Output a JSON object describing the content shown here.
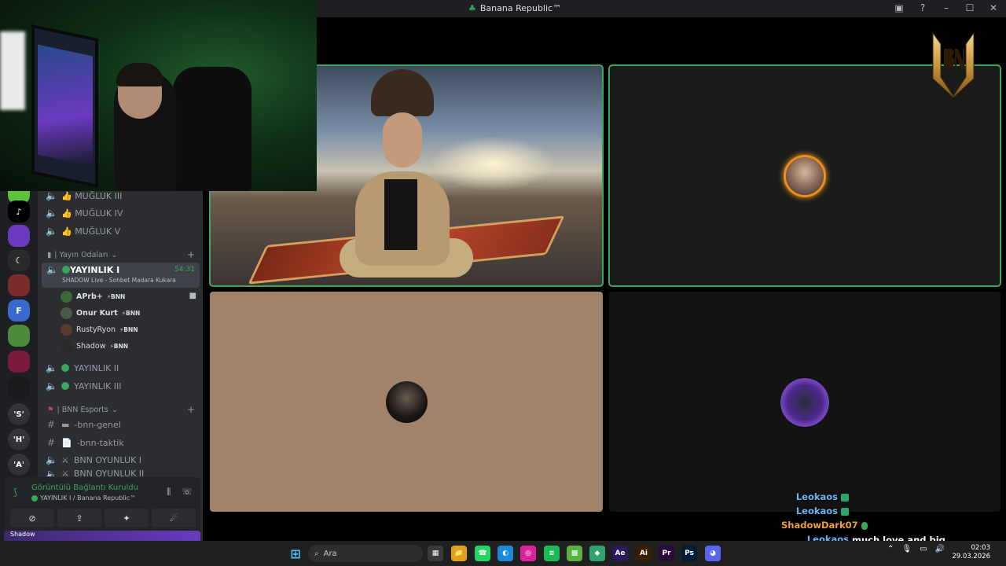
{
  "window": {
    "title": "Banana Republic™"
  },
  "sidebar": {
    "servers": [
      {
        "label": "",
        "color": "#5dc23a"
      },
      {
        "label": "♪",
        "color": "#000000"
      },
      {
        "label": "",
        "color": "#6a3ac0"
      },
      {
        "label": "☾",
        "color": "#2a2a2a"
      },
      {
        "label": "",
        "color": "#7a2a2a"
      },
      {
        "label": "F",
        "color": "#3a6ad0"
      },
      {
        "label": "",
        "color": "#4a8a3a"
      },
      {
        "label": "",
        "color": "#7a1a3a"
      },
      {
        "label": "",
        "color": "#1a1a1a"
      },
      {
        "label": "'S'",
        "color": "#313338"
      },
      {
        "label": "'H'",
        "color": "#313338"
      },
      {
        "label": "'A'",
        "color": "#313338"
      }
    ],
    "top_channels": [
      {
        "icon": "🔈",
        "label": "👍 MUĞLUK III"
      },
      {
        "icon": "🔈",
        "label": "👍 MUĞLUK IV"
      },
      {
        "icon": "🔈",
        "label": "👍 MUĞLUK V"
      }
    ],
    "category_stream": {
      "label": "| Yayın Odaları",
      "icon": "▮"
    },
    "active_channel": {
      "name": "YAYINLIK I",
      "timer": "54:31",
      "status": "SHADOW Live - Sohbet Madara Kukara"
    },
    "members": [
      {
        "name": "APrb+",
        "tag": "⚡BNN",
        "camera": true
      },
      {
        "name": "Onur Kurt",
        "tag": "⚡BNN",
        "camera": false
      },
      {
        "name": "RustyRyon",
        "tag": "⚡BNN",
        "camera": false
      },
      {
        "name": "Shadow",
        "tag": "⚡BNN",
        "camera": false
      }
    ],
    "more_stream_channels": [
      {
        "label": "YAYINLIK II"
      },
      {
        "label": "YAYINLIK III"
      }
    ],
    "category_esports": {
      "label": "| BNN Esports"
    },
    "esports_channels": [
      {
        "icon": "#",
        "label": "-bnn-genel",
        "emoji": "▬"
      },
      {
        "icon": "#",
        "label": "-bnn-taktik",
        "emoji": "📄"
      },
      {
        "icon": "🔈",
        "label": "BNN OYUNLUK I",
        "emoji": "⚔"
      },
      {
        "icon": "🔈",
        "label": "BNN OYUNLUK II",
        "emoji": "⚔"
      }
    ],
    "voice_panel": {
      "status": "Görüntülü Bağlantı Kuruldu",
      "subtitle": "YAYINLIK I / Banana Republic™",
      "buttons": [
        "⊘",
        "⇪",
        "✦",
        "☄"
      ]
    },
    "user_strip": "Shadow"
  },
  "chat": [
    {
      "nick": "Leokaos",
      "color": "#6cb4f0",
      "message": ""
    },
    {
      "nick": "Leokaos",
      "color": "#6cb4f0",
      "message": ""
    },
    {
      "nick": "ShadowDark07",
      "color": "#f0a030",
      "message": ""
    },
    {
      "nick": "Leokaos",
      "color": "#6cb4f0",
      "message": "much love and big support! lets go!"
    }
  ],
  "taskbar": {
    "search_placeholder": "Ara",
    "time": "02:03",
    "date": "29.03.2026",
    "apps": [
      {
        "label": "▦",
        "color": "#3a3a3a"
      },
      {
        "label": "📁",
        "color": "#e0a020"
      },
      {
        "label": "☎",
        "color": "#25d366"
      },
      {
        "label": "◐",
        "color": "#1a8ad8"
      },
      {
        "label": "◎",
        "color": "#d6249f"
      },
      {
        "label": "≋",
        "color": "#1db954"
      },
      {
        "label": "▩",
        "color": "#5ab040"
      },
      {
        "label": "◆",
        "color": "#2fa36b"
      },
      {
        "label": "Ae",
        "color": "#2a1a5a"
      },
      {
        "label": "Ai",
        "color": "#3a1e00"
      },
      {
        "label": "Pr",
        "color": "#2a0a3a"
      },
      {
        "label": "Ps",
        "color": "#001e36"
      },
      {
        "label": "◕",
        "color": "#5865f2"
      }
    ]
  },
  "colors": {
    "accent_green": "#3ba55c",
    "speaking_outline": "#3ba55c"
  }
}
